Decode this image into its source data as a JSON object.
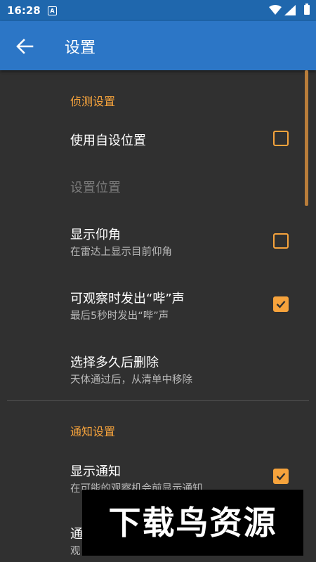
{
  "status_bar": {
    "time": "16:28",
    "notification_icon_letter": "A",
    "icons": [
      "wifi-icon",
      "signal-icon",
      "battery-icon"
    ]
  },
  "app_bar": {
    "title": "设置",
    "back_icon": "arrow-left-icon",
    "color": "#2c76c6"
  },
  "accent_color": "#f6a33c",
  "sections": [
    {
      "header": "侦测设置",
      "items": [
        {
          "title": "使用自设位置",
          "subtitle": "",
          "checkbox": true,
          "checked": false,
          "enabled": true
        },
        {
          "title": "设置位置",
          "subtitle": "",
          "checkbox": false,
          "enabled": false
        },
        {
          "title": "显示仰角",
          "subtitle": "在雷达上显示目前仰角",
          "checkbox": true,
          "checked": false,
          "enabled": true
        },
        {
          "title": "可观察时发出“哔”声",
          "subtitle": "最后5秒时发出“哔”声",
          "checkbox": true,
          "checked": true,
          "enabled": true
        },
        {
          "title": "选择多久后删除",
          "subtitle": "天体通过后，从清单中移除",
          "checkbox": false,
          "enabled": true
        }
      ]
    },
    {
      "header": "通知设置",
      "items": [
        {
          "title": "显示通知",
          "subtitle": "在可能的观察机会前显示通知",
          "checkbox": true,
          "checked": true,
          "enabled": true
        },
        {
          "title": "通",
          "subtitle": "观",
          "checkbox": false,
          "enabled": true
        }
      ]
    }
  ],
  "watermark": "下载鸟资源"
}
